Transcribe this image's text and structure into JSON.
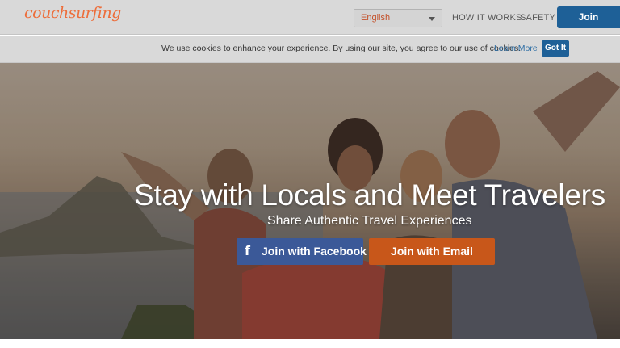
{
  "header": {
    "logo": "couchsurfing",
    "language": "English",
    "nav": [
      "HOW IT WORKS",
      "SAFETY"
    ],
    "join_label": "Join"
  },
  "cookie_bar": {
    "message": "We use cookies to enhance your experience. By using our site, you agree to our use of cookies.",
    "learn_more": "Learn More",
    "got_it": "Got It"
  },
  "hero": {
    "title": "Stay with Locals and Meet Travelers",
    "subtitle": "Share Authentic Travel Experiences",
    "facebook_icon": "f",
    "facebook_label": "Join with Facebook",
    "email_label": "Join with Email"
  },
  "colors": {
    "brand": "#ed6d3a",
    "primary": "#1e6097",
    "facebook": "#3b5998",
    "email": "#c8571a",
    "header_bg": "#d9d9d9"
  },
  "icons": {
    "language_caret": "chevron-down-icon",
    "facebook": "facebook-icon"
  }
}
